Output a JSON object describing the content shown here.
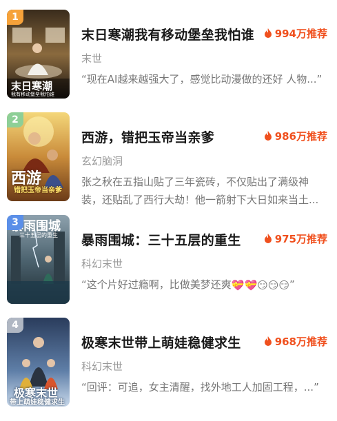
{
  "items": [
    {
      "rank": "1",
      "rank_color": "#f6a23a",
      "title": "末日寒潮我有移动堡垒我怕谁",
      "hot": "994万推荐",
      "genre": "末世",
      "desc": "“现在AI越来越强大了，感觉比动漫做的还好 人物...”",
      "cover_text_main": "末日寒潮",
      "cover_text_sub": "我有移动堡垒我怕谁"
    },
    {
      "rank": "2",
      "rank_color": "#8ecf97",
      "title": "西游，错把玉帝当亲爹",
      "hot": "986万推荐",
      "genre": "玄幻脑洞",
      "desc": "张之秋在五指山贴了三年瓷砖，不仅贴出了满级神装，还贴乱了西行大劫！他一箭射下大日如来当土...",
      "cover_text_main": "西游",
      "cover_text_sub": "错把玉帝当亲爹"
    },
    {
      "rank": "3",
      "rank_color": "#5b8fe8",
      "title": "暴雨围城：三十五层的重生",
      "hot": "975万推荐",
      "genre": "科幻末世",
      "desc": "“这个片好过瘾啊，比做美梦还爽",
      "desc_emojis": "💝💝😏😏😏",
      "desc_end": "”",
      "cover_text_main": "暴雨围城",
      "cover_text_sub": "三十五层的重生"
    },
    {
      "rank": "4",
      "rank_color": "#b0b7c3",
      "title": "极寒末世带上萌娃稳健求生",
      "hot": "968万推荐",
      "genre": "科幻末世",
      "desc": "“回评：可追，女主清醒，找外地工人加固工程，...”",
      "cover_text_main": "极寒末世",
      "cover_text_sub": "带上萌娃稳健求生"
    }
  ],
  "icons": {
    "hot": "flame-icon"
  }
}
